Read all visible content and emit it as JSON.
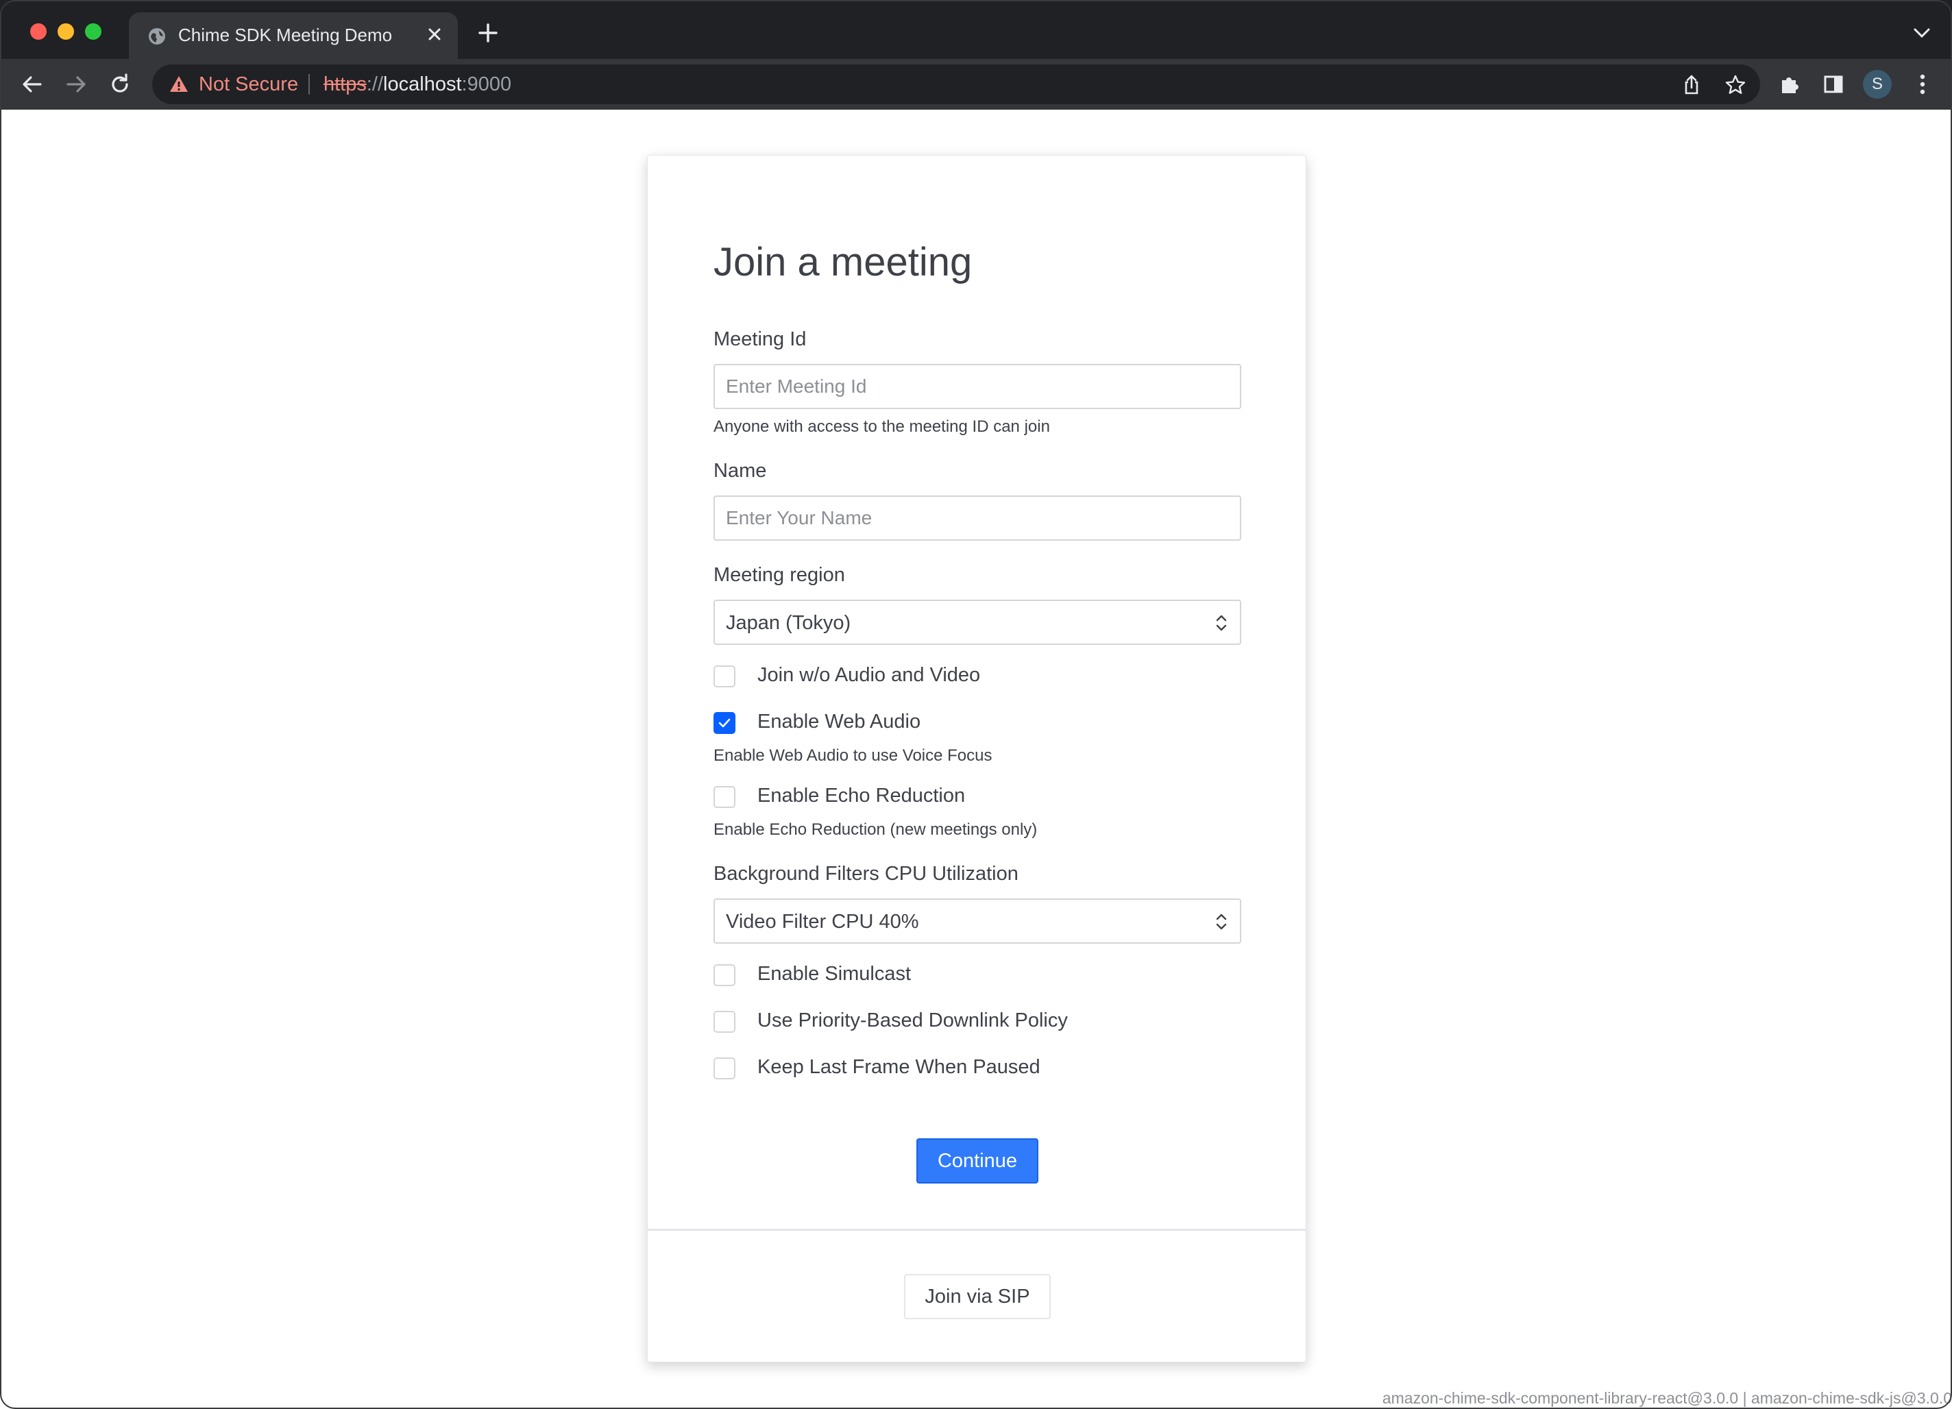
{
  "browser": {
    "tab": {
      "title": "Chime SDK Meeting Demo"
    },
    "address_bar": {
      "security_label": "Not Secure",
      "url_scheme": "https",
      "url_separator": "://",
      "url_host": "localhost",
      "url_port": ":9000"
    },
    "profile_initial": "S"
  },
  "page": {
    "title": "Join a meeting",
    "meeting_id": {
      "label": "Meeting Id",
      "placeholder": "Enter Meeting Id",
      "value": "",
      "hint": "Anyone with access to the meeting ID can join"
    },
    "name": {
      "label": "Name",
      "placeholder": "Enter Your Name",
      "value": ""
    },
    "meeting_region": {
      "label": "Meeting region",
      "selected": "Japan (Tokyo)"
    },
    "checkboxes": {
      "join_without_av": {
        "label": "Join w/o Audio and Video",
        "checked": false
      },
      "web_audio": {
        "label": "Enable Web Audio",
        "checked": true,
        "hint": "Enable Web Audio to use Voice Focus"
      },
      "echo_reduction": {
        "label": "Enable Echo Reduction",
        "checked": false,
        "hint": "Enable Echo Reduction (new meetings only)"
      },
      "simulcast": {
        "label": "Enable Simulcast",
        "checked": false
      },
      "priority_downlink": {
        "label": "Use Priority-Based Downlink Policy",
        "checked": false
      },
      "keep_last_frame": {
        "label": "Keep Last Frame When Paused",
        "checked": false
      }
    },
    "background_filters": {
      "label": "Background Filters CPU Utilization",
      "selected": "Video Filter CPU 40%"
    },
    "continue_button": "Continue",
    "sip_button": "Join via SIP",
    "footer_versions": "amazon-chime-sdk-component-library-react@3.0.0 | amazon-chime-sdk-js@3.0.0"
  },
  "colors": {
    "primary": "#2f7bfc",
    "checkbox_checked": "#075fff",
    "not_secure": "#f28b82"
  }
}
